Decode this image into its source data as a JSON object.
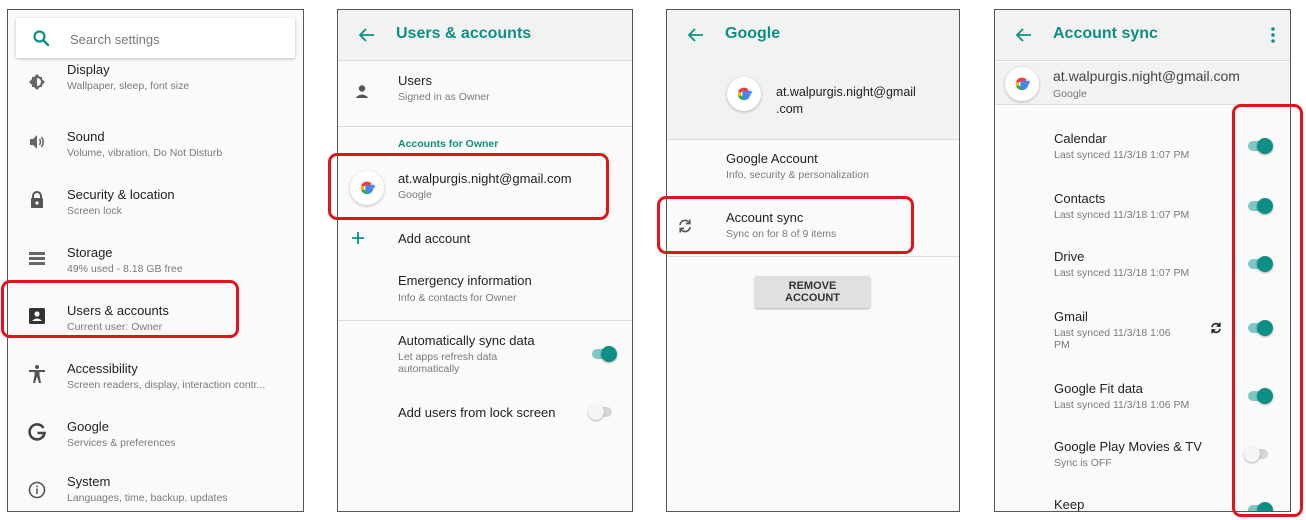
{
  "colors": {
    "accent": "#0e8f85",
    "highlight": "#e3131b"
  },
  "settings": {
    "search_placeholder": "Search settings",
    "items": [
      {
        "icon": "display-icon",
        "title": "Display",
        "subtitle": "Wallpaper, sleep, font size"
      },
      {
        "icon": "sound-icon",
        "title": "Sound",
        "subtitle": "Volume, vibration, Do Not Disturb"
      },
      {
        "icon": "lock-icon",
        "title": "Security & location",
        "subtitle": "Screen lock"
      },
      {
        "icon": "storage-icon",
        "title": "Storage",
        "subtitle": "49% used - 8.18 GB free"
      },
      {
        "icon": "account-box-icon",
        "title": "Users & accounts",
        "subtitle": "Current user: Owner"
      },
      {
        "icon": "accessibility-icon",
        "title": "Accessibility",
        "subtitle": "Screen readers, display, interaction contr..."
      },
      {
        "icon": "google-g-icon",
        "title": "Google",
        "subtitle": "Services & preferences"
      },
      {
        "icon": "info-icon",
        "title": "System",
        "subtitle": "Languages, time, backup, updates"
      }
    ]
  },
  "users_accounts": {
    "title": "Users & accounts",
    "users_title": "Users",
    "users_subtitle": "Signed in as Owner",
    "section_label": "Accounts for Owner",
    "account_email": "at.walpurgis.night@gmail.com",
    "account_type": "Google",
    "add_account": "Add account",
    "emergency_title": "Emergency information",
    "emergency_subtitle": "Info & contacts for Owner",
    "auto_sync_title": "Automatically sync data",
    "auto_sync_subtitle_1": "Let apps refresh data",
    "auto_sync_subtitle_2": "automatically",
    "auto_sync_on": true,
    "lock_screen_title": "Add users from lock screen",
    "lock_screen_on": false
  },
  "google": {
    "title": "Google",
    "email_line1": "at.walpurgis.night@gmail",
    "email_line2": ".com",
    "google_account_title": "Google Account",
    "google_account_subtitle": "Info, security & personalization",
    "account_sync_title": "Account sync",
    "account_sync_subtitle": "Sync on for 8 of 9 items",
    "remove_button": "REMOVE ACCOUNT"
  },
  "account_sync": {
    "title": "Account sync",
    "email": "at.walpurgis.night@gmail.com",
    "account_type": "Google",
    "items": [
      {
        "title": "Calendar",
        "status": "Last synced 11/3/18 1:07 PM",
        "on": true
      },
      {
        "title": "Contacts",
        "status": "Last synced 11/3/18 1:07 PM",
        "on": true
      },
      {
        "title": "Drive",
        "status": "Last synced 11/3/18 1:07 PM",
        "on": true
      },
      {
        "title": "Gmail",
        "status": "Last synced 11/3/18 1:06",
        "status2": "PM",
        "on": true,
        "syncing": true
      },
      {
        "title": "Google Fit data",
        "status": "Last synced 11/3/18 1:06 PM",
        "on": true
      },
      {
        "title": "Google Play Movies & TV",
        "status": "Sync is OFF",
        "on": false
      },
      {
        "title": "Keep",
        "status": "",
        "on": true
      }
    ]
  }
}
